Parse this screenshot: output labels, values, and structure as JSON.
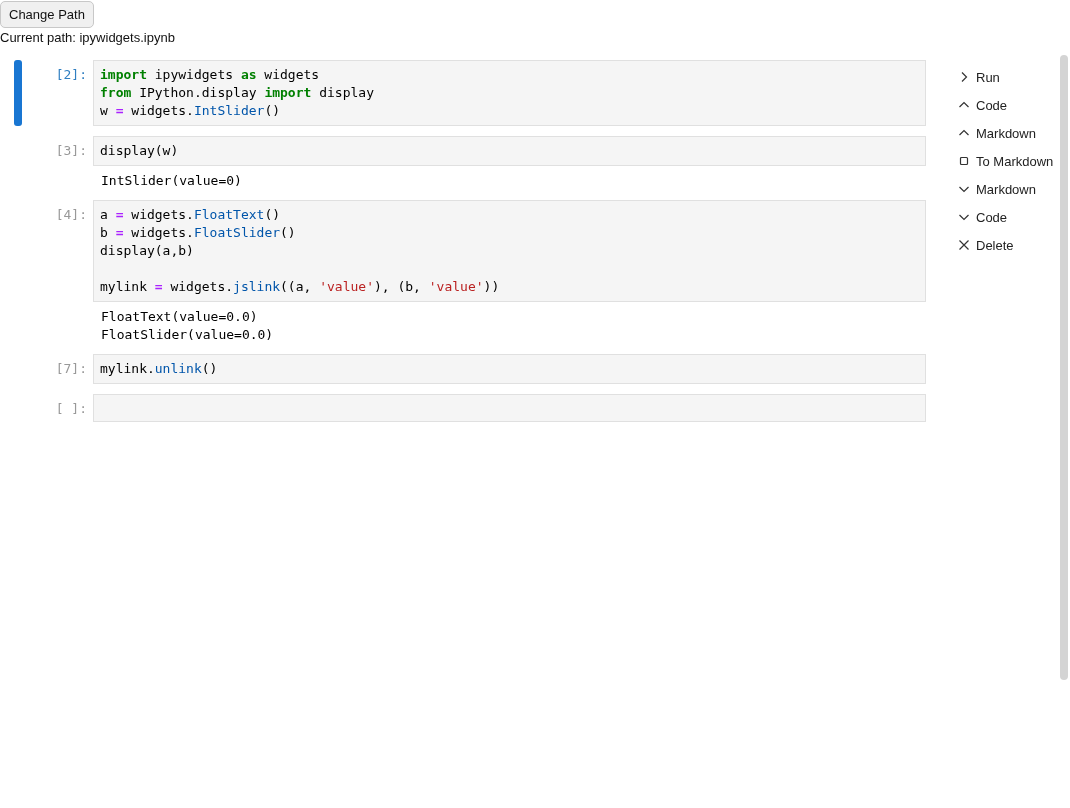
{
  "change_path_button": {
    "label": "Change Path"
  },
  "current_path": "Current path: ipywidgets.ipynb",
  "cells": [
    {
      "prompt": "[2]:",
      "selected": true,
      "code": [
        {
          "kind": "code",
          "tokens": [
            {
              "kind": "kw",
              "text": "import"
            },
            {
              "kind": "plain",
              "text": " ipywidgets "
            },
            {
              "kind": "kw",
              "text": "as"
            },
            {
              "kind": "plain",
              "text": " widgets"
            }
          ]
        },
        {
          "kind": "code",
          "tokens": [
            {
              "kind": "kw",
              "text": "from"
            },
            {
              "kind": "plain",
              "text": " IPython.display "
            },
            {
              "kind": "kw",
              "text": "import"
            },
            {
              "kind": "plain",
              "text": " display"
            }
          ]
        },
        {
          "kind": "code",
          "tokens": [
            {
              "kind": "plain",
              "text": "w "
            },
            {
              "kind": "op",
              "text": "="
            },
            {
              "kind": "plain",
              "text": " widgets."
            },
            {
              "kind": "name",
              "text": "IntSlider"
            },
            {
              "kind": "plain",
              "text": "()"
            }
          ]
        }
      ]
    },
    {
      "prompt": "[3]:",
      "selected": false,
      "code": [
        {
          "kind": "code",
          "tokens": [
            {
              "kind": "plain",
              "text": "display(w)"
            }
          ]
        }
      ],
      "output": [
        "IntSlider(value=0)"
      ]
    },
    {
      "prompt": "[4]:",
      "selected": false,
      "code": [
        {
          "kind": "code",
          "tokens": [
            {
              "kind": "plain",
              "text": "a "
            },
            {
              "kind": "op",
              "text": "="
            },
            {
              "kind": "plain",
              "text": " widgets."
            },
            {
              "kind": "name",
              "text": "FloatText"
            },
            {
              "kind": "plain",
              "text": "()"
            }
          ]
        },
        {
          "kind": "code",
          "tokens": [
            {
              "kind": "plain",
              "text": "b "
            },
            {
              "kind": "op",
              "text": "="
            },
            {
              "kind": "plain",
              "text": " widgets."
            },
            {
              "kind": "name",
              "text": "FloatSlider"
            },
            {
              "kind": "plain",
              "text": "()"
            }
          ]
        },
        {
          "kind": "code",
          "tokens": [
            {
              "kind": "plain",
              "text": "display(a,b)"
            }
          ]
        },
        {
          "kind": "blank"
        },
        {
          "kind": "code",
          "tokens": [
            {
              "kind": "plain",
              "text": "mylink "
            },
            {
              "kind": "op",
              "text": "="
            },
            {
              "kind": "plain",
              "text": " widgets."
            },
            {
              "kind": "name",
              "text": "jslink"
            },
            {
              "kind": "plain",
              "text": "((a, "
            },
            {
              "kind": "str",
              "text": "'value'"
            },
            {
              "kind": "plain",
              "text": "), (b, "
            },
            {
              "kind": "str",
              "text": "'value'"
            },
            {
              "kind": "plain",
              "text": "))"
            }
          ]
        }
      ],
      "output": [
        "FloatText(value=0.0)",
        "FloatSlider(value=0.0)"
      ]
    },
    {
      "prompt": "[7]:",
      "selected": false,
      "code": [
        {
          "kind": "code",
          "tokens": [
            {
              "kind": "plain",
              "text": "mylink."
            },
            {
              "kind": "name",
              "text": "unlink"
            },
            {
              "kind": "plain",
              "text": "()"
            }
          ]
        }
      ]
    },
    {
      "prompt": "[ ]:",
      "selected": false
    }
  ],
  "actions": [
    {
      "kind": "run",
      "label": "Run"
    },
    {
      "kind": "up",
      "label": "Code"
    },
    {
      "kind": "up",
      "label": "Markdown"
    },
    {
      "kind": "square",
      "label": "To Markdown"
    },
    {
      "kind": "down",
      "label": "Markdown"
    },
    {
      "kind": "down",
      "label": "Code"
    },
    {
      "kind": "delete",
      "label": "Delete"
    }
  ]
}
